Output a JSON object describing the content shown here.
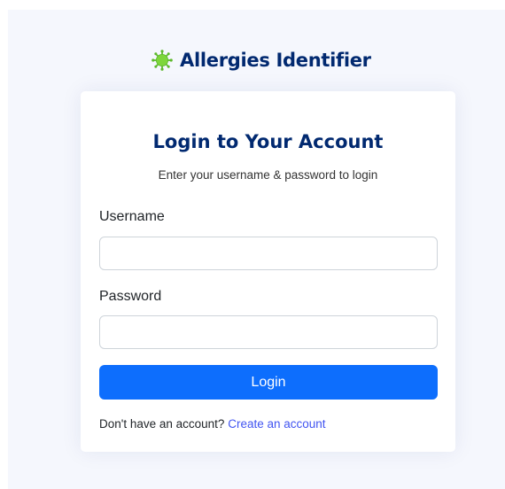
{
  "brand": {
    "name": "Allergies Identifier",
    "icon": "virus-icon",
    "icon_color": "#7dd63a"
  },
  "card": {
    "title": "Login to Your Account",
    "subtitle": "Enter your username & password to login"
  },
  "form": {
    "username_label": "Username",
    "username_value": "",
    "password_label": "Password",
    "password_value": "",
    "login_button": "Login"
  },
  "signup": {
    "prompt": "Don't have an account?",
    "link_text": "Create an account"
  },
  "colors": {
    "brand_text": "#012970",
    "primary_button": "#0d6efd",
    "link": "#4154f1",
    "page_background": "#f5f7fd"
  }
}
